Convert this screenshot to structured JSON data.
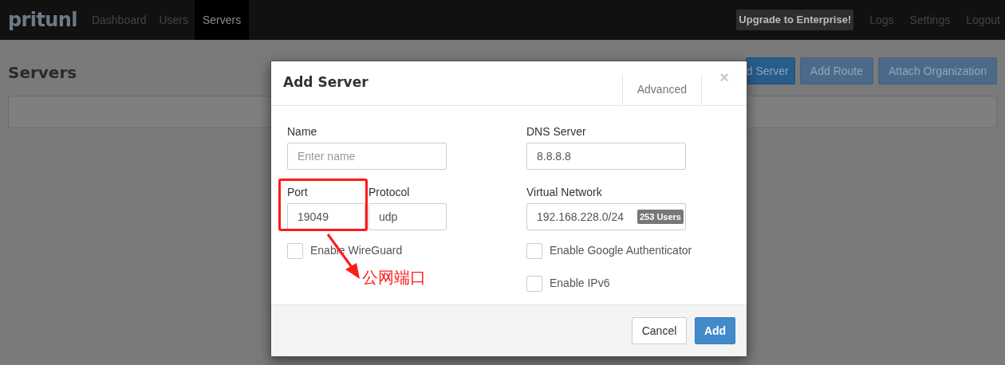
{
  "navbar": {
    "logo": "pritunl",
    "links": [
      {
        "label": "Dashboard",
        "selected": false
      },
      {
        "label": "Users",
        "selected": false
      },
      {
        "label": "Servers",
        "selected": true
      }
    ],
    "upgrade": "Upgrade to Enterprise!",
    "right_links": [
      "Logs",
      "Settings",
      "Logout"
    ]
  },
  "page": {
    "title": "Servers",
    "buttons": [
      {
        "label": "d Server",
        "kind": "primary"
      },
      {
        "label": "Add Route",
        "kind": "default"
      },
      {
        "label": "Attach Organization",
        "kind": "default"
      }
    ]
  },
  "dialog": {
    "title": "Add Server",
    "advanced_tab": "Advanced",
    "close": "×",
    "name": {
      "label": "Name",
      "placeholder": "Enter name"
    },
    "port": {
      "label": "Port",
      "value": "19049"
    },
    "protocol": {
      "label": "Protocol",
      "value": "udp"
    },
    "dns": {
      "label": "DNS Server",
      "value": "8.8.8.8"
    },
    "virtual_network": {
      "label": "Virtual Network",
      "value": "192.168.228.0/24",
      "badge": "253 Users"
    },
    "left_checkboxes": [
      {
        "label": "Enable WireGuard",
        "checked": false
      }
    ],
    "right_checkboxes": [
      {
        "label": "Enable Google Authenticator",
        "checked": false
      },
      {
        "label": "Enable IPv6",
        "checked": false
      }
    ],
    "footer_buttons": [
      {
        "label": "Cancel",
        "kind": "default"
      },
      {
        "label": "Add",
        "kind": "primary"
      }
    ]
  },
  "annotation": {
    "label": "公网端口"
  }
}
